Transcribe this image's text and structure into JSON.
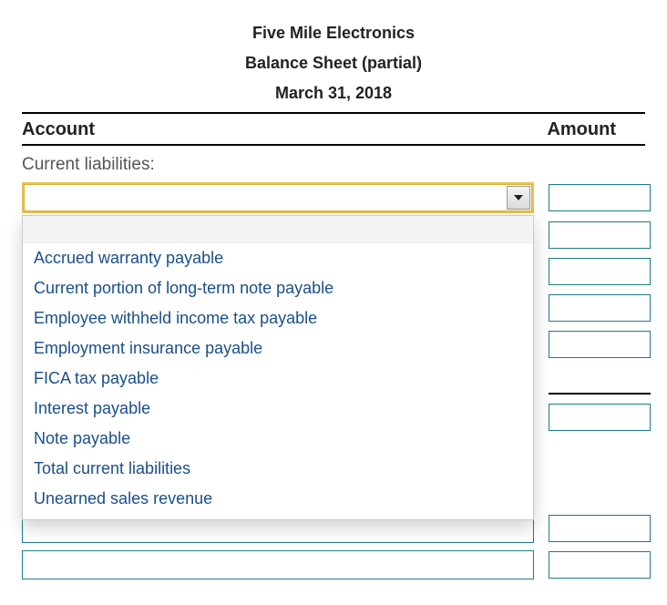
{
  "header": {
    "company": "Five Mile Electronics",
    "report": "Balance Sheet (partial)",
    "date": "March 31, 2018"
  },
  "columns": {
    "account": "Account",
    "amount": "Amount"
  },
  "section_label": "Current liabilities:",
  "dropdown": {
    "options": [
      "Accrued warranty payable",
      "Current portion of long-term note payable",
      "Employee withheld income tax payable",
      "Employment insurance payable",
      "FICA tax payable",
      "Interest payable",
      "Note payable",
      "Total current liabilities",
      "Unearned sales revenue"
    ]
  },
  "rows": {
    "amount_values": [
      "",
      "",
      "",
      "",
      "",
      "",
      "",
      ""
    ]
  }
}
